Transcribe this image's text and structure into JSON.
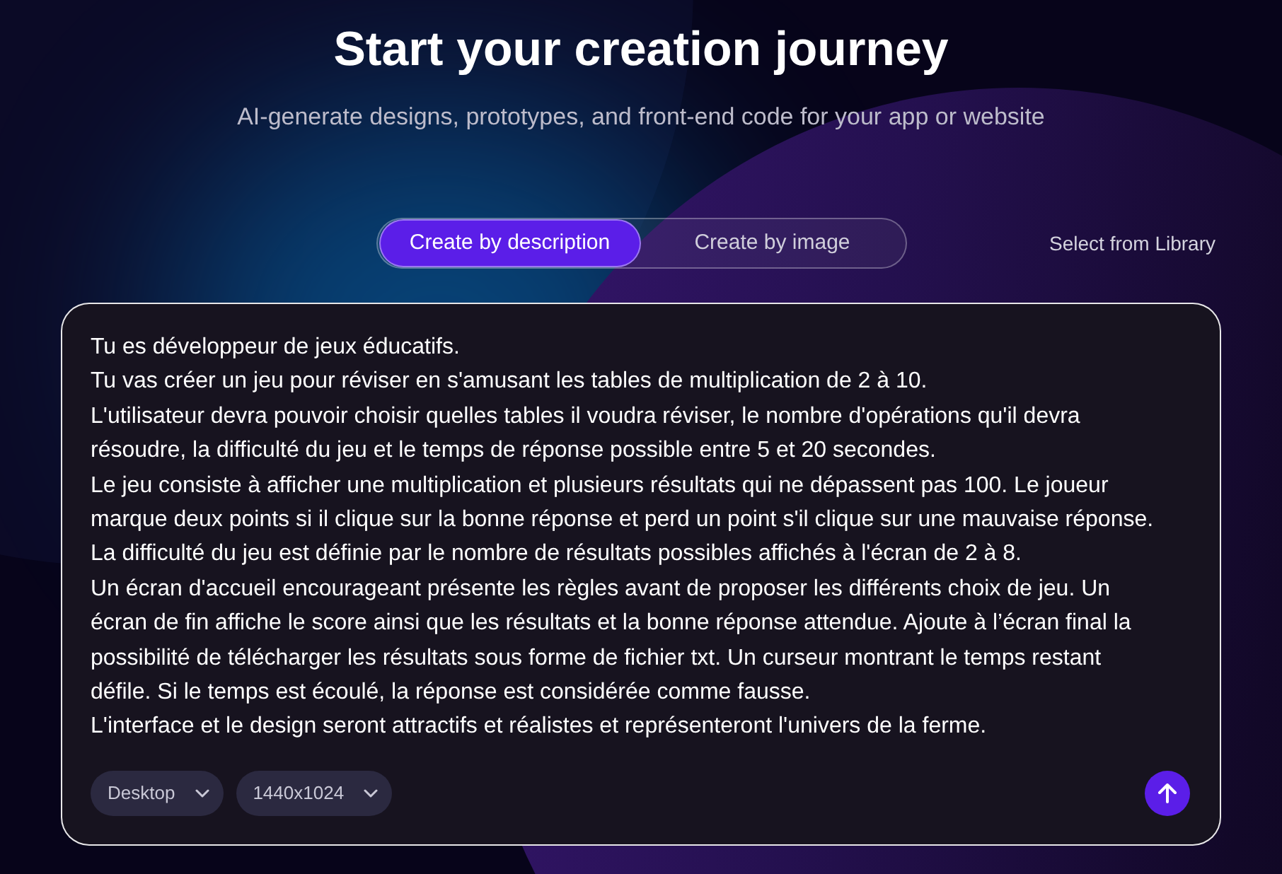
{
  "header": {
    "title": "Start your creation journey",
    "subtitle": "AI-generate designs, prototypes, and front-end code for your app or website"
  },
  "tabs": [
    {
      "label": "Create by description",
      "selected": true
    },
    {
      "label": "Create by image",
      "selected": false
    }
  ],
  "library_link": {
    "label": "Select from Library"
  },
  "prompt": {
    "value": "Tu es développeur de jeux éducatifs.\nTu vas créer un jeu pour réviser en s'amusant les tables de multiplication de 2 à 10.\nL'utilisateur devra pouvoir choisir quelles tables il voudra réviser, le nombre d'opérations qu'il devra résoudre, la difficulté du jeu et le temps de réponse possible entre 5 et 20 secondes.\nLe jeu consiste à afficher une multiplication et plusieurs résultats qui ne dépassent pas 100. Le joueur marque deux points si il clique sur la bonne réponse et perd un point s'il clique sur une mauvaise réponse.\nLa difficulté du jeu est définie par le nombre de résultats possibles affichés à l'écran de 2 à 8.\nUn écran d'accueil encourageant présente les règles avant de proposer les différents choix de jeu. Un écran de fin affiche le score ainsi que les résultats et la bonne réponse attendue. Ajoute à l’écran final la possibilité de télécharger les résultats sous forme de fichier txt. Un curseur montrant le temps restant défile. Si le temps est écoulé, la réponse est considérée comme fausse.\nL'interface et le design seront attractifs et réalistes et représenteront l'univers de la ferme."
  },
  "options": [
    {
      "label": "Desktop"
    },
    {
      "label": "1440x1024"
    }
  ]
}
